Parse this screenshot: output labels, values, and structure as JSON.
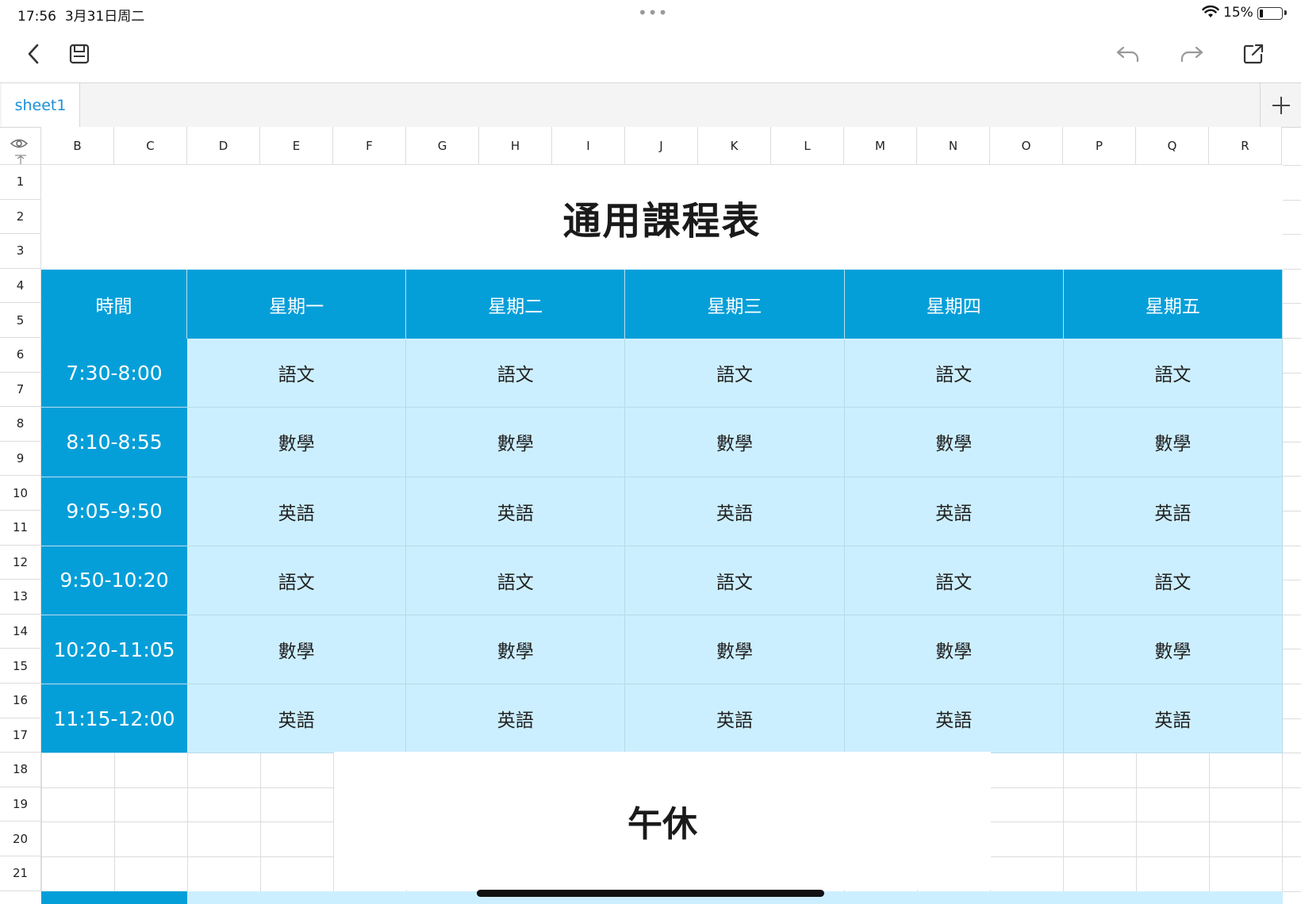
{
  "status_bar": {
    "time": "17:56",
    "date": "3月31日周二",
    "battery": "15%",
    "battery_level": 0.15,
    "more": "•••"
  },
  "toolbar": {
    "back_icon": "chevron-left-icon",
    "save_icon": "save-icon",
    "undo_icon": "undo-icon",
    "redo_icon": "redo-icon",
    "share_icon": "share-icon"
  },
  "tabs": [
    {
      "label": "sheet1",
      "active": true
    }
  ],
  "columns": [
    "B",
    "C",
    "D",
    "E",
    "F",
    "G",
    "H",
    "I",
    "J",
    "K",
    "L",
    "M",
    "N",
    "O",
    "P",
    "Q",
    "R"
  ],
  "rows": [
    "1",
    "2",
    "3",
    "4",
    "5",
    "6",
    "7",
    "8",
    "9",
    "10",
    "11",
    "12",
    "13",
    "14",
    "15",
    "16",
    "17",
    "18",
    "19",
    "20",
    "21"
  ],
  "sheet": {
    "title": "通用課程表",
    "header": {
      "time": "時間",
      "days": [
        "星期一",
        "星期二",
        "星期三",
        "星期四",
        "星期五"
      ]
    },
    "schedule": [
      {
        "time": "7:30-8:00",
        "subjects": [
          "語文",
          "語文",
          "語文",
          "語文",
          "語文"
        ]
      },
      {
        "time": "8:10-8:55",
        "subjects": [
          "數學",
          "數學",
          "數學",
          "數學",
          "數學"
        ]
      },
      {
        "time": "9:05-9:50",
        "subjects": [
          "英語",
          "英語",
          "英語",
          "英語",
          "英語"
        ]
      },
      {
        "time": "9:50-10:20",
        "subjects": [
          "語文",
          "語文",
          "語文",
          "語文",
          "語文"
        ]
      },
      {
        "time": "10:20-11:05",
        "subjects": [
          "數學",
          "數學",
          "數學",
          "數學",
          "數學"
        ]
      },
      {
        "time": "11:15-12:00",
        "subjects": [
          "英語",
          "英語",
          "英語",
          "英語",
          "英語"
        ]
      }
    ],
    "break_label": "午休"
  },
  "colors": {
    "header_blue": "#049fd9",
    "light_blue": "#ccefff",
    "tab_text": "#1a8fd8"
  }
}
